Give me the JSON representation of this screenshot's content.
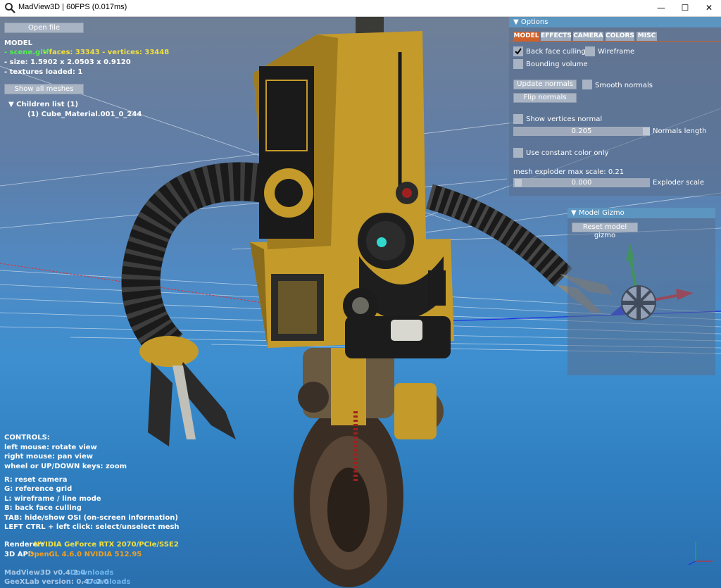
{
  "window": {
    "title": "MadView3D | 60FPS (0.017ms)",
    "minimize": "—",
    "maximize": "☐",
    "close": "✕"
  },
  "left_panel": {
    "open_file": "Open file",
    "model_header": "MODEL",
    "file_name": "- scene.gltf",
    "faces_vertices": "- faces: 33343 - vertices: 33448",
    "size": "- size:  1.5902 x 2.0503 x 0.9120",
    "textures": "- textures loaded: 1",
    "show_all_meshes": "Show all meshes",
    "children_list": "Children list (1)",
    "child_item": "(1) Cube_Material.001_0_244"
  },
  "controls": {
    "header": "CONTROLS:",
    "lines": [
      "left mouse: rotate view",
      "right mouse: pan view",
      "wheel or UP/DOWN keys: zoom"
    ],
    "keys": [
      "R: reset camera",
      "G: reference grid",
      "L: wireframe / line mode",
      "B: back face culling",
      "TAB: hide/show OSI (on-screen information)",
      "LEFT CTRL + left click: select/unselect mesh"
    ],
    "renderer_label": "Renderer:",
    "renderer_value": "NVIDIA GeForce RTX 2070/PCIe/SSE2",
    "api_label": "3D API:",
    "api_value": "OpenGL 4.6.0 NVIDIA 512.95",
    "version": "MadView3D v0.4.2.0",
    "geexlab": "GeeXLab version: 0.47.2.0",
    "downloads1": "- Downloads",
    "downloads2": "- Downloads"
  },
  "options": {
    "header": "Options",
    "tabs": [
      "MODEL",
      "EFFECTS",
      "CAMERA",
      "COLORS",
      "MISC"
    ],
    "back_face_culling": "Back face culling",
    "wireframe": "Wireframe",
    "bounding_volume": "Bounding volume",
    "update_normals": "Update normals",
    "smooth_normals": "Smooth normals",
    "flip_normals": "Flip normals",
    "show_vertices_normal": "Show vertices normal",
    "normals_length_value": "0.205",
    "normals_length_label": "Normals length",
    "use_constant_color": "Use constant color only",
    "exploder_max": "mesh exploder max scale: 0.21",
    "exploder_value": "0.000",
    "exploder_label": "Exploder scale"
  },
  "gizmo": {
    "header": "Model Gizmo",
    "reset": "Reset model gizmo"
  },
  "colors": {
    "robot_body": "#c49a2a",
    "robot_dark": "#1c1c1c",
    "eye": "#30d8d0",
    "axis_red": "#e02020",
    "axis_green": "#20c020",
    "axis_blue": "#2030e0"
  }
}
